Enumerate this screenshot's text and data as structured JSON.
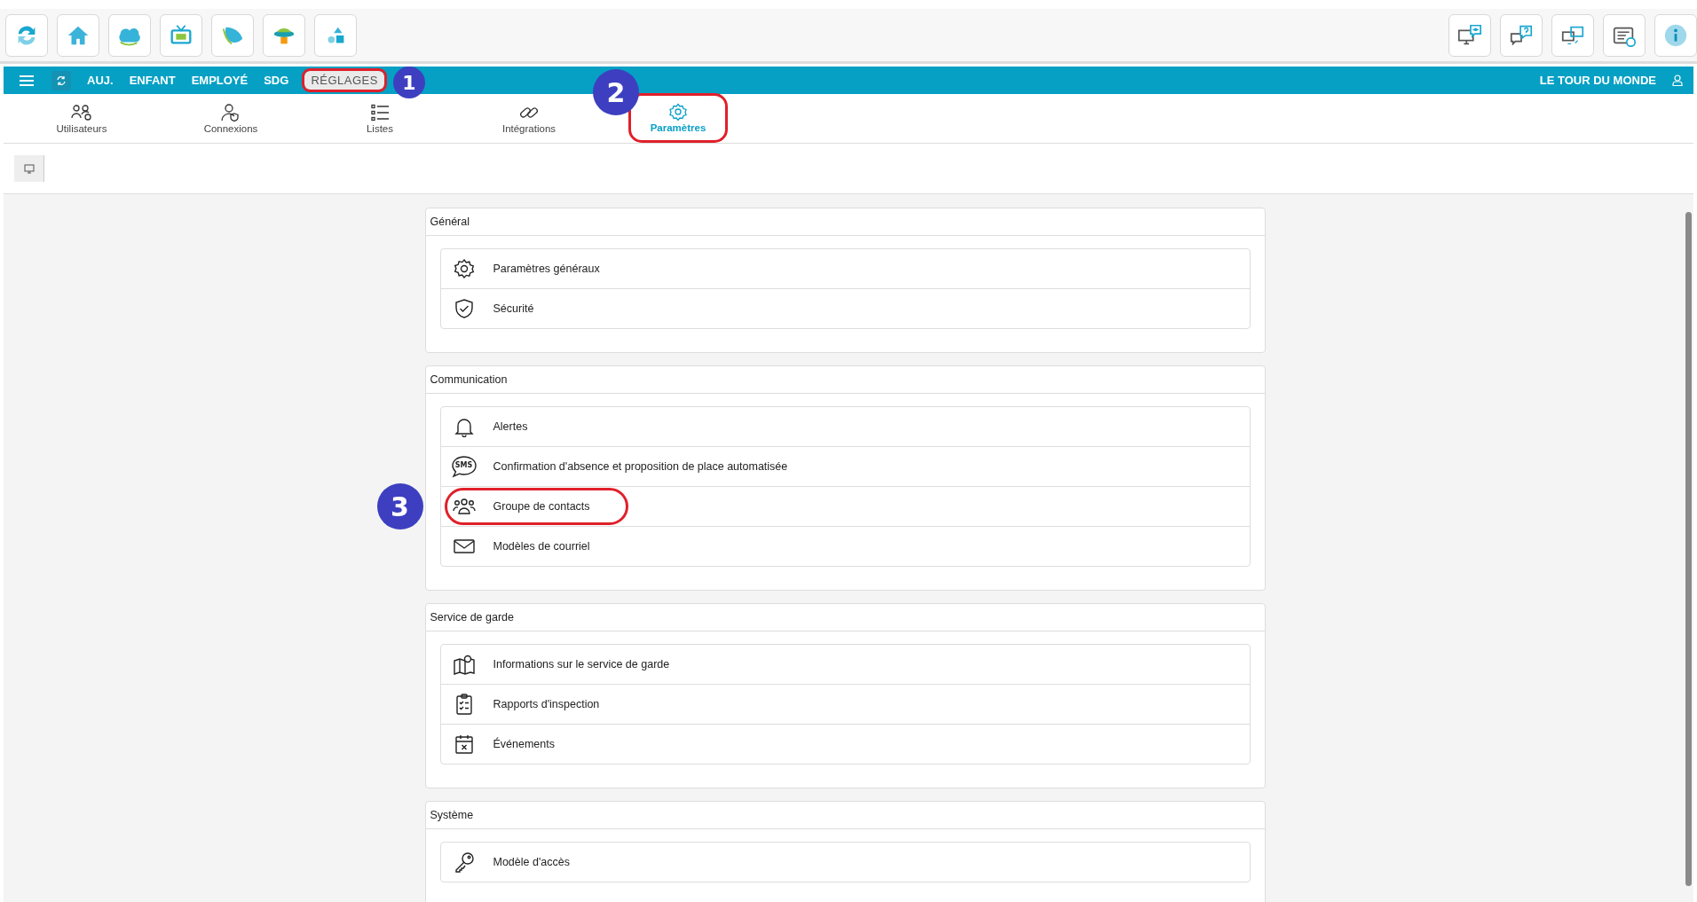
{
  "nav": {
    "items": [
      {
        "label": "AUJ.",
        "selected": false
      },
      {
        "label": "ENFANT",
        "selected": false
      },
      {
        "label": "EMPLOYÉ",
        "selected": false
      },
      {
        "label": "SDG",
        "selected": false
      },
      {
        "label": "RÉGLAGES",
        "selected": true,
        "callout": "1"
      }
    ],
    "organization": "LE TOUR DU MONDE"
  },
  "subtabs": [
    {
      "label": "Utilisateurs",
      "selected": false
    },
    {
      "label": "Connexions",
      "selected": false
    },
    {
      "label": "Listes",
      "selected": false
    },
    {
      "label": "Intégrations",
      "selected": false
    },
    {
      "label": "Paramètres",
      "selected": true,
      "callout": "2"
    }
  ],
  "sections": [
    {
      "title": "Général",
      "items": [
        {
          "label": "Paramètres généraux"
        },
        {
          "label": "Sécurité"
        }
      ]
    },
    {
      "title": "Communication",
      "items": [
        {
          "label": "Alertes"
        },
        {
          "label": "Confirmation d'absence et proposition de place automatisée",
          "icon_text": "SMS"
        },
        {
          "label": "Groupe de contacts",
          "callout": "3"
        },
        {
          "label": "Modèles de courriel"
        }
      ]
    },
    {
      "title": "Service de garde",
      "items": [
        {
          "label": "Informations sur le service de garde"
        },
        {
          "label": "Rapports d'inspection"
        },
        {
          "label": "Événements"
        }
      ]
    },
    {
      "title": "Système",
      "items": [
        {
          "label": "Modèle d'accès"
        }
      ]
    }
  ]
}
